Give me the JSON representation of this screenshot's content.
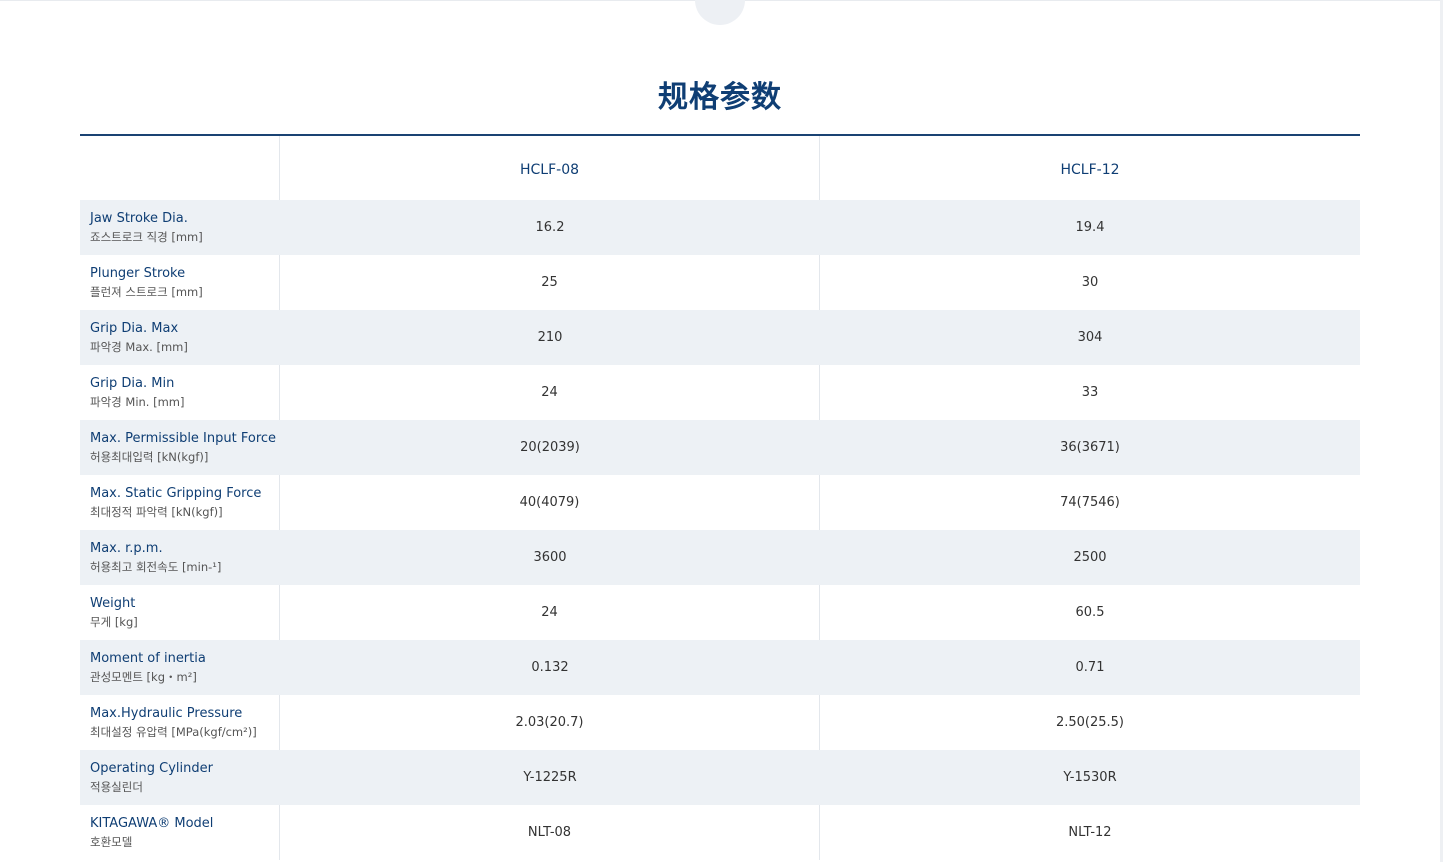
{
  "page": {
    "title": "规格参数"
  },
  "table": {
    "models": [
      "HCLF-08",
      "HCLF-12"
    ],
    "rows": [
      {
        "label_en": "Jaw Stroke Dia.",
        "label_ko": "죠스트로크 직경 [mm]",
        "values": [
          "16.2",
          "19.4"
        ]
      },
      {
        "label_en": "Plunger Stroke",
        "label_ko": "플런져 스트로크 [mm]",
        "values": [
          "25",
          "30"
        ]
      },
      {
        "label_en": "Grip Dia. Max",
        "label_ko": "파악경 Max. [mm]",
        "values": [
          "210",
          "304"
        ]
      },
      {
        "label_en": "Grip Dia. Min",
        "label_ko": "파악경 Min. [mm]",
        "values": [
          "24",
          "33"
        ]
      },
      {
        "label_en": "Max. Permissible Input Force",
        "label_ko": "허용최대입력 [kN(kgf)]",
        "values": [
          "20(2039)",
          "36(3671)"
        ]
      },
      {
        "label_en": "Max. Static Gripping Force",
        "label_ko": "최대정적 파악력 [kN(kgf)]",
        "values": [
          "40(4079)",
          "74(7546)"
        ]
      },
      {
        "label_en": "Max. r.p.m.",
        "label_ko": "허용최고 회전속도 [min-¹]",
        "values": [
          "3600",
          "2500"
        ]
      },
      {
        "label_en": "Weight",
        "label_ko": "무게 [kg]",
        "values": [
          "24",
          "60.5"
        ]
      },
      {
        "label_en": "Moment of inertia",
        "label_ko": "관성모멘트 [kg・m²]",
        "values": [
          "0.132",
          "0.71"
        ]
      },
      {
        "label_en": "Max.Hydraulic Pressure",
        "label_ko": "최대설정 유압력 [MPa(kgf/cm²)]",
        "values": [
          "2.03(20.7)",
          "2.50(25.5)"
        ]
      },
      {
        "label_en": "Operating Cylinder",
        "label_ko": "적용실린더",
        "values": [
          "Y-1225R",
          "Y-1530R"
        ]
      },
      {
        "label_en": "KITAGAWA® Model",
        "label_ko": "호환모델",
        "values": [
          "NLT-08",
          "NLT-12"
        ]
      }
    ]
  },
  "colors": {
    "accent": "#0f3e74",
    "row_shade": "#edf1f5",
    "rule": "#1a4373"
  }
}
